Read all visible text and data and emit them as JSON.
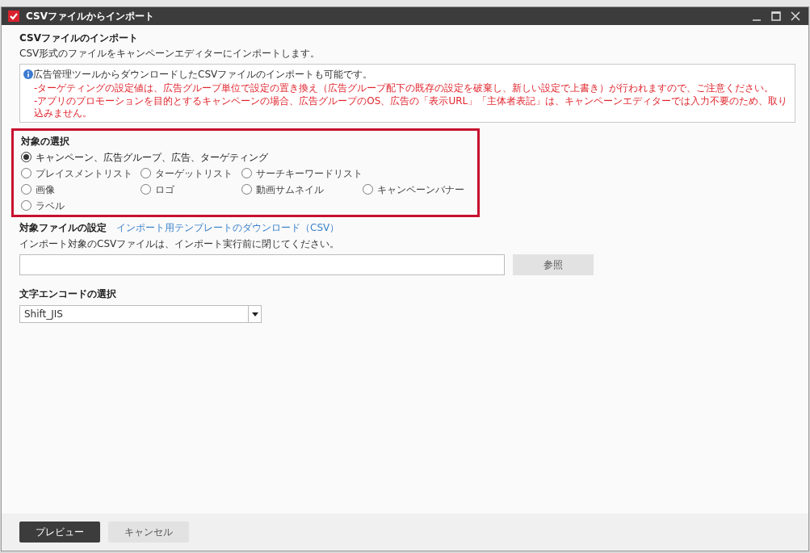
{
  "window": {
    "title": "CSVファイルからインポート"
  },
  "header": {
    "title": "CSVファイルのインポート",
    "description": "CSV形式のファイルをキャンペーンエディターにインポートします。"
  },
  "notice": {
    "info": "広告管理ツールからダウンロードしたCSVファイルのインポートも可能です。",
    "warnings": [
      "-ターゲティングの設定値は、広告グループ単位で設定の置き換え（広告グループ配下の既存の設定を破棄し、新しい設定で上書き）が行われますので、ご注意ください。",
      "-アプリのプロモーションを目的とするキャンペーンの場合、広告グループのOS、広告の「表示URL」「主体者表記」は、キャンペーンエディターでは入力不要のため、取り込みません。"
    ]
  },
  "target_selection": {
    "title": "対象の選択",
    "highlighted": true,
    "rows": [
      [
        {
          "label": "キャンペーン、広告グループ、広告、ターゲティング",
          "selected": true
        }
      ],
      [
        {
          "label": "プレイスメントリスト",
          "selected": false
        },
        {
          "label": "ターゲットリスト",
          "selected": false
        },
        {
          "label": "サーチキーワードリスト",
          "selected": false
        }
      ],
      [
        {
          "label": "画像",
          "selected": false
        },
        {
          "label": "ロゴ",
          "selected": false
        },
        {
          "label": "動画サムネイル",
          "selected": false
        },
        {
          "label": "キャンペーンバナー",
          "selected": false
        }
      ],
      [
        {
          "label": "ラベル",
          "selected": false
        }
      ]
    ]
  },
  "file_settings": {
    "title": "対象ファイルの設定",
    "template_link": "インポート用テンプレートのダウンロード（CSV）",
    "note": "インポート対象のCSVファイルは、インポート実行前に閉じてください。",
    "browse_button": "参照"
  },
  "encoding": {
    "title": "文字エンコードの選択",
    "value": "Shift_JIS"
  },
  "buttons": [
    {
      "label": "プレビュー",
      "primary": true
    },
    {
      "label": "キャンセル",
      "primary": false
    }
  ]
}
